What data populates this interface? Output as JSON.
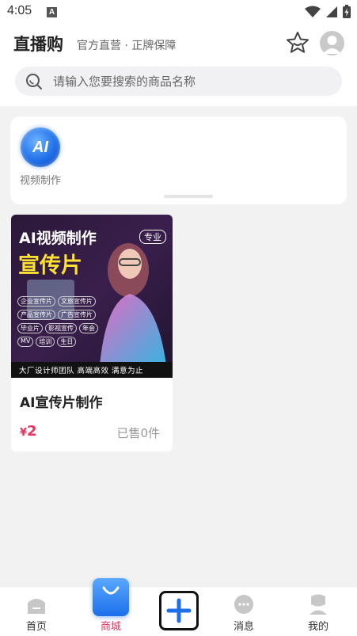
{
  "status_bar": {
    "time": "4:05",
    "notification_letter": "A"
  },
  "header": {
    "title": "直播购",
    "subtitle": "官方直营 · 正牌保障",
    "search_placeholder": "请输入您要搜索的商品名称"
  },
  "categories": [
    {
      "label": "视频制作",
      "icon_text": "AI"
    }
  ],
  "products": [
    {
      "name": "AI宣传片制作",
      "price_symbol": "¥",
      "price": "2",
      "sold": "已售0件",
      "image_text": {
        "headline": "AI视频制作",
        "big": "宣传片",
        "badge": "专业",
        "tags": [
          "企业宣传片",
          "文旅宣传片",
          "产品宣传片",
          "广告宣传片",
          "毕业片",
          "影视宣传",
          "年会",
          "MV",
          "培训",
          "生日"
        ],
        "footer": "大厂设计师团队 高端高效 满意为止"
      }
    }
  ],
  "bottom_nav": [
    {
      "label": "首页",
      "icon": "home-icon"
    },
    {
      "label": "商城",
      "icon": "shopping-bag-icon",
      "active": true
    },
    {
      "label": "",
      "icon": "plus-icon"
    },
    {
      "label": "消息",
      "icon": "message-icon"
    },
    {
      "label": "我的",
      "icon": "user-icon"
    }
  ],
  "colors": {
    "accent": "#e8335b",
    "brand_blue": "#1f6fe8",
    "background": "#f2f2f2"
  }
}
